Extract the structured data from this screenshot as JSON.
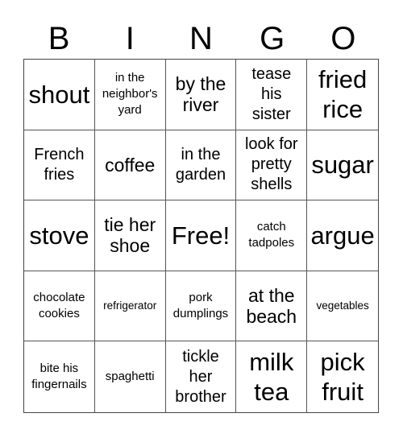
{
  "header": [
    "B",
    "I",
    "N",
    "G",
    "O"
  ],
  "cells": [
    {
      "text": "shout",
      "size": "xl"
    },
    {
      "text": "in the neighbor's yard",
      "size": "sm"
    },
    {
      "text": "by the river",
      "size": "lg"
    },
    {
      "text": "tease his sister",
      "size": "md"
    },
    {
      "text": "fried rice",
      "size": "xl"
    },
    {
      "text": "French fries",
      "size": "md"
    },
    {
      "text": "coffee",
      "size": "lg"
    },
    {
      "text": "in the garden",
      "size": "md"
    },
    {
      "text": "look for pretty shells",
      "size": "md"
    },
    {
      "text": "sugar",
      "size": "xl"
    },
    {
      "text": "stove",
      "size": "xl"
    },
    {
      "text": "tie her shoe",
      "size": "lg"
    },
    {
      "text": "Free!",
      "size": "xl"
    },
    {
      "text": "catch tadpoles",
      "size": "sm"
    },
    {
      "text": "argue",
      "size": "xl"
    },
    {
      "text": "chocolate cookies",
      "size": "sm"
    },
    {
      "text": "refrigerator",
      "size": "xs"
    },
    {
      "text": "pork dumplings",
      "size": "sm"
    },
    {
      "text": "at the beach",
      "size": "lg"
    },
    {
      "text": "vegetables",
      "size": "xs"
    },
    {
      "text": "bite his fingernails",
      "size": "sm"
    },
    {
      "text": "spaghetti",
      "size": "sm"
    },
    {
      "text": "tickle her brother",
      "size": "md"
    },
    {
      "text": "milk tea",
      "size": "xl"
    },
    {
      "text": "pick fruit",
      "size": "xl"
    }
  ]
}
